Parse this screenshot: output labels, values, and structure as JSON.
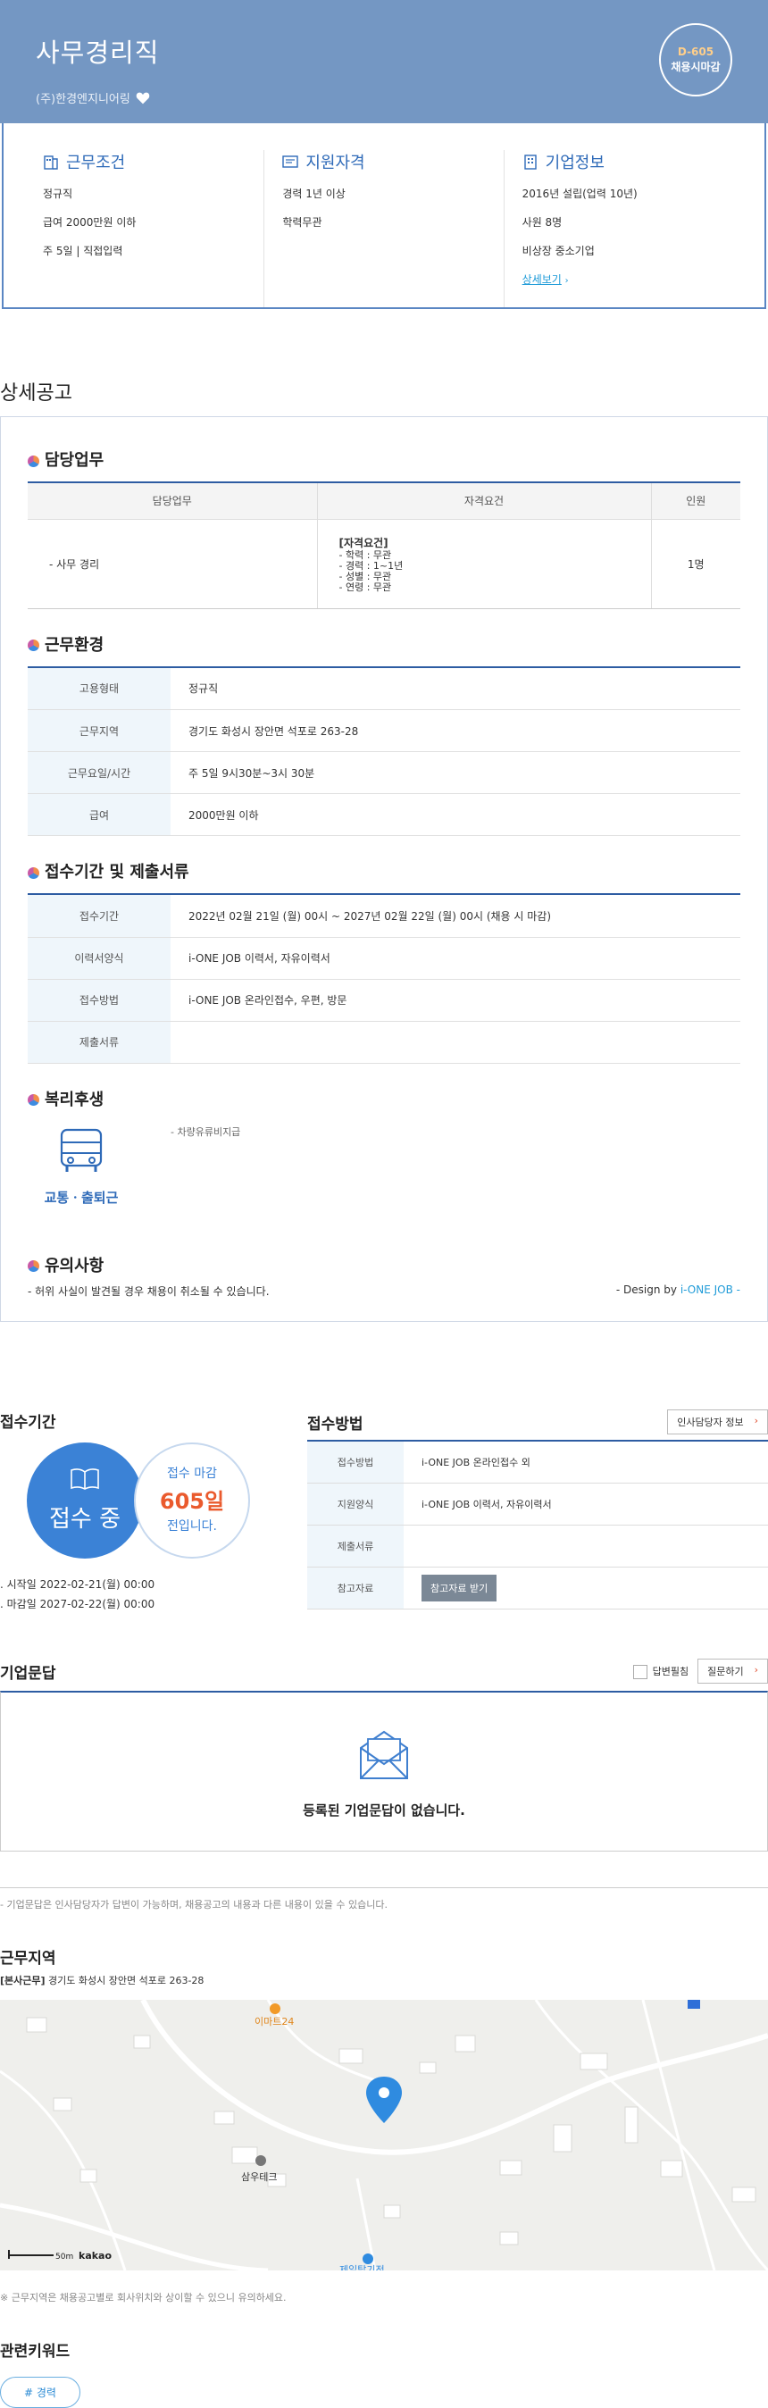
{
  "header": {
    "title": "사무경리직",
    "company": "(주)한경엔지니어링",
    "dday": "D-605",
    "dday_status": "채용시마감"
  },
  "summary": {
    "conditions": {
      "title": "근무조건",
      "items": [
        "정규직",
        "급여 2000만원 이하",
        "주 5일 | 직접입력"
      ]
    },
    "qualification": {
      "title": "지원자격",
      "items": [
        "경력 1년 이상",
        "학력무관"
      ]
    },
    "company": {
      "title": "기업정보",
      "items": [
        "2016년 설립(업력 10년)",
        "사원 8명",
        "비상장 중소기업"
      ],
      "link": "상세보기"
    }
  },
  "detail": {
    "title": "상세공고",
    "duty": {
      "heading": "담당업무",
      "columns": [
        "담당업무",
        "자격요건",
        "인원"
      ],
      "row": {
        "duty": "- 사무 경리",
        "qual_title": "[자격요건]",
        "qual_items": [
          "- 학력 : 무관",
          "- 경력 : 1~1년",
          "- 성별 : 무관",
          "- 연령 : 무관"
        ],
        "count": "1명"
      }
    },
    "environment": {
      "heading": "근무환경",
      "rows": [
        {
          "label": "고용형태",
          "value": "정규직"
        },
        {
          "label": "근무지역",
          "value": "경기도 화성시 장안면 석포로 263-28"
        },
        {
          "label": "근무요일/시간",
          "value": "주 5일 9시30분~3시 30분"
        },
        {
          "label": "급여",
          "value": "2000만원 이하"
        }
      ]
    },
    "reception": {
      "heading": "접수기간 및 제출서류",
      "rows": [
        {
          "label": "접수기간",
          "value": "2022년 02월 21일 (월) 00시 ~ 2027년 02월 22일 (월) 00시 (채용 시 마감)"
        },
        {
          "label": "이력서양식",
          "value": "i-ONE JOB 이력서, 자유이력서"
        },
        {
          "label": "접수방법",
          "value": "i-ONE JOB 온라인접수, 우편, 방문"
        },
        {
          "label": "제출서류",
          "value": ""
        }
      ]
    },
    "welfare": {
      "heading": "복리후생",
      "card_label": "교통ㆍ출퇴근",
      "note": "- 차량유류비지급"
    },
    "caution": {
      "heading": "유의사항",
      "text": "- 허위 사실이 발견될 경우 채용이 취소될 수 있습니다."
    },
    "design_by": "- Design by",
    "design_brand": "i-ONE JOB -"
  },
  "apply": {
    "period_title": "접수기간",
    "status": "접수 중",
    "deadline_label": "접수 마감",
    "deadline_days": "605일",
    "deadline_suffix": "전입니다.",
    "start": "시작일 2022-02-21(월) 00:00",
    "end": "마감일 2027-02-22(월) 00:00",
    "method_title": "접수방법",
    "contact_button": "인사담당자 정보",
    "rows": [
      {
        "label": "접수방법",
        "value": "i-ONE JOB 온라인접수 외"
      },
      {
        "label": "지원양식",
        "value": "i-ONE JOB 이력서, 자유이력서"
      },
      {
        "label": "제출서류",
        "value": ""
      },
      {
        "label": "참고자료",
        "value": ""
      }
    ],
    "ref_button": "참고자료 받기"
  },
  "qna": {
    "title": "기업문답",
    "checkbox_label": "답변필침",
    "ask_button": "질문하기",
    "empty": "등록된 기업문답이 없습니다.",
    "note": "- 기업문답은 인사담당자가 답변이 가능하며, 채용공고의 내용과 다른 내용이 있을 수 있습니다."
  },
  "area": {
    "title": "근무지역",
    "addr_tag": "[본사근무]",
    "addr": "경기도 화성시 장안면 석포로 263-28",
    "map_labels": {
      "poi1": "이마트24",
      "poi2": "삼우테크",
      "poi3": "제일탑기전",
      "scale": "50m",
      "brand": "kakao"
    },
    "note": "※ 근무지역은 채용공고별로 회사위치와 상이할 수 있으니 유의하세요."
  },
  "keywords": {
    "title": "관련키워드",
    "items": [
      "# 경력"
    ]
  },
  "colors": {
    "hero": "#7497c3",
    "accent": "#2d5ca2",
    "link": "#1f9bd8",
    "deadline": "#ea5a2d"
  }
}
